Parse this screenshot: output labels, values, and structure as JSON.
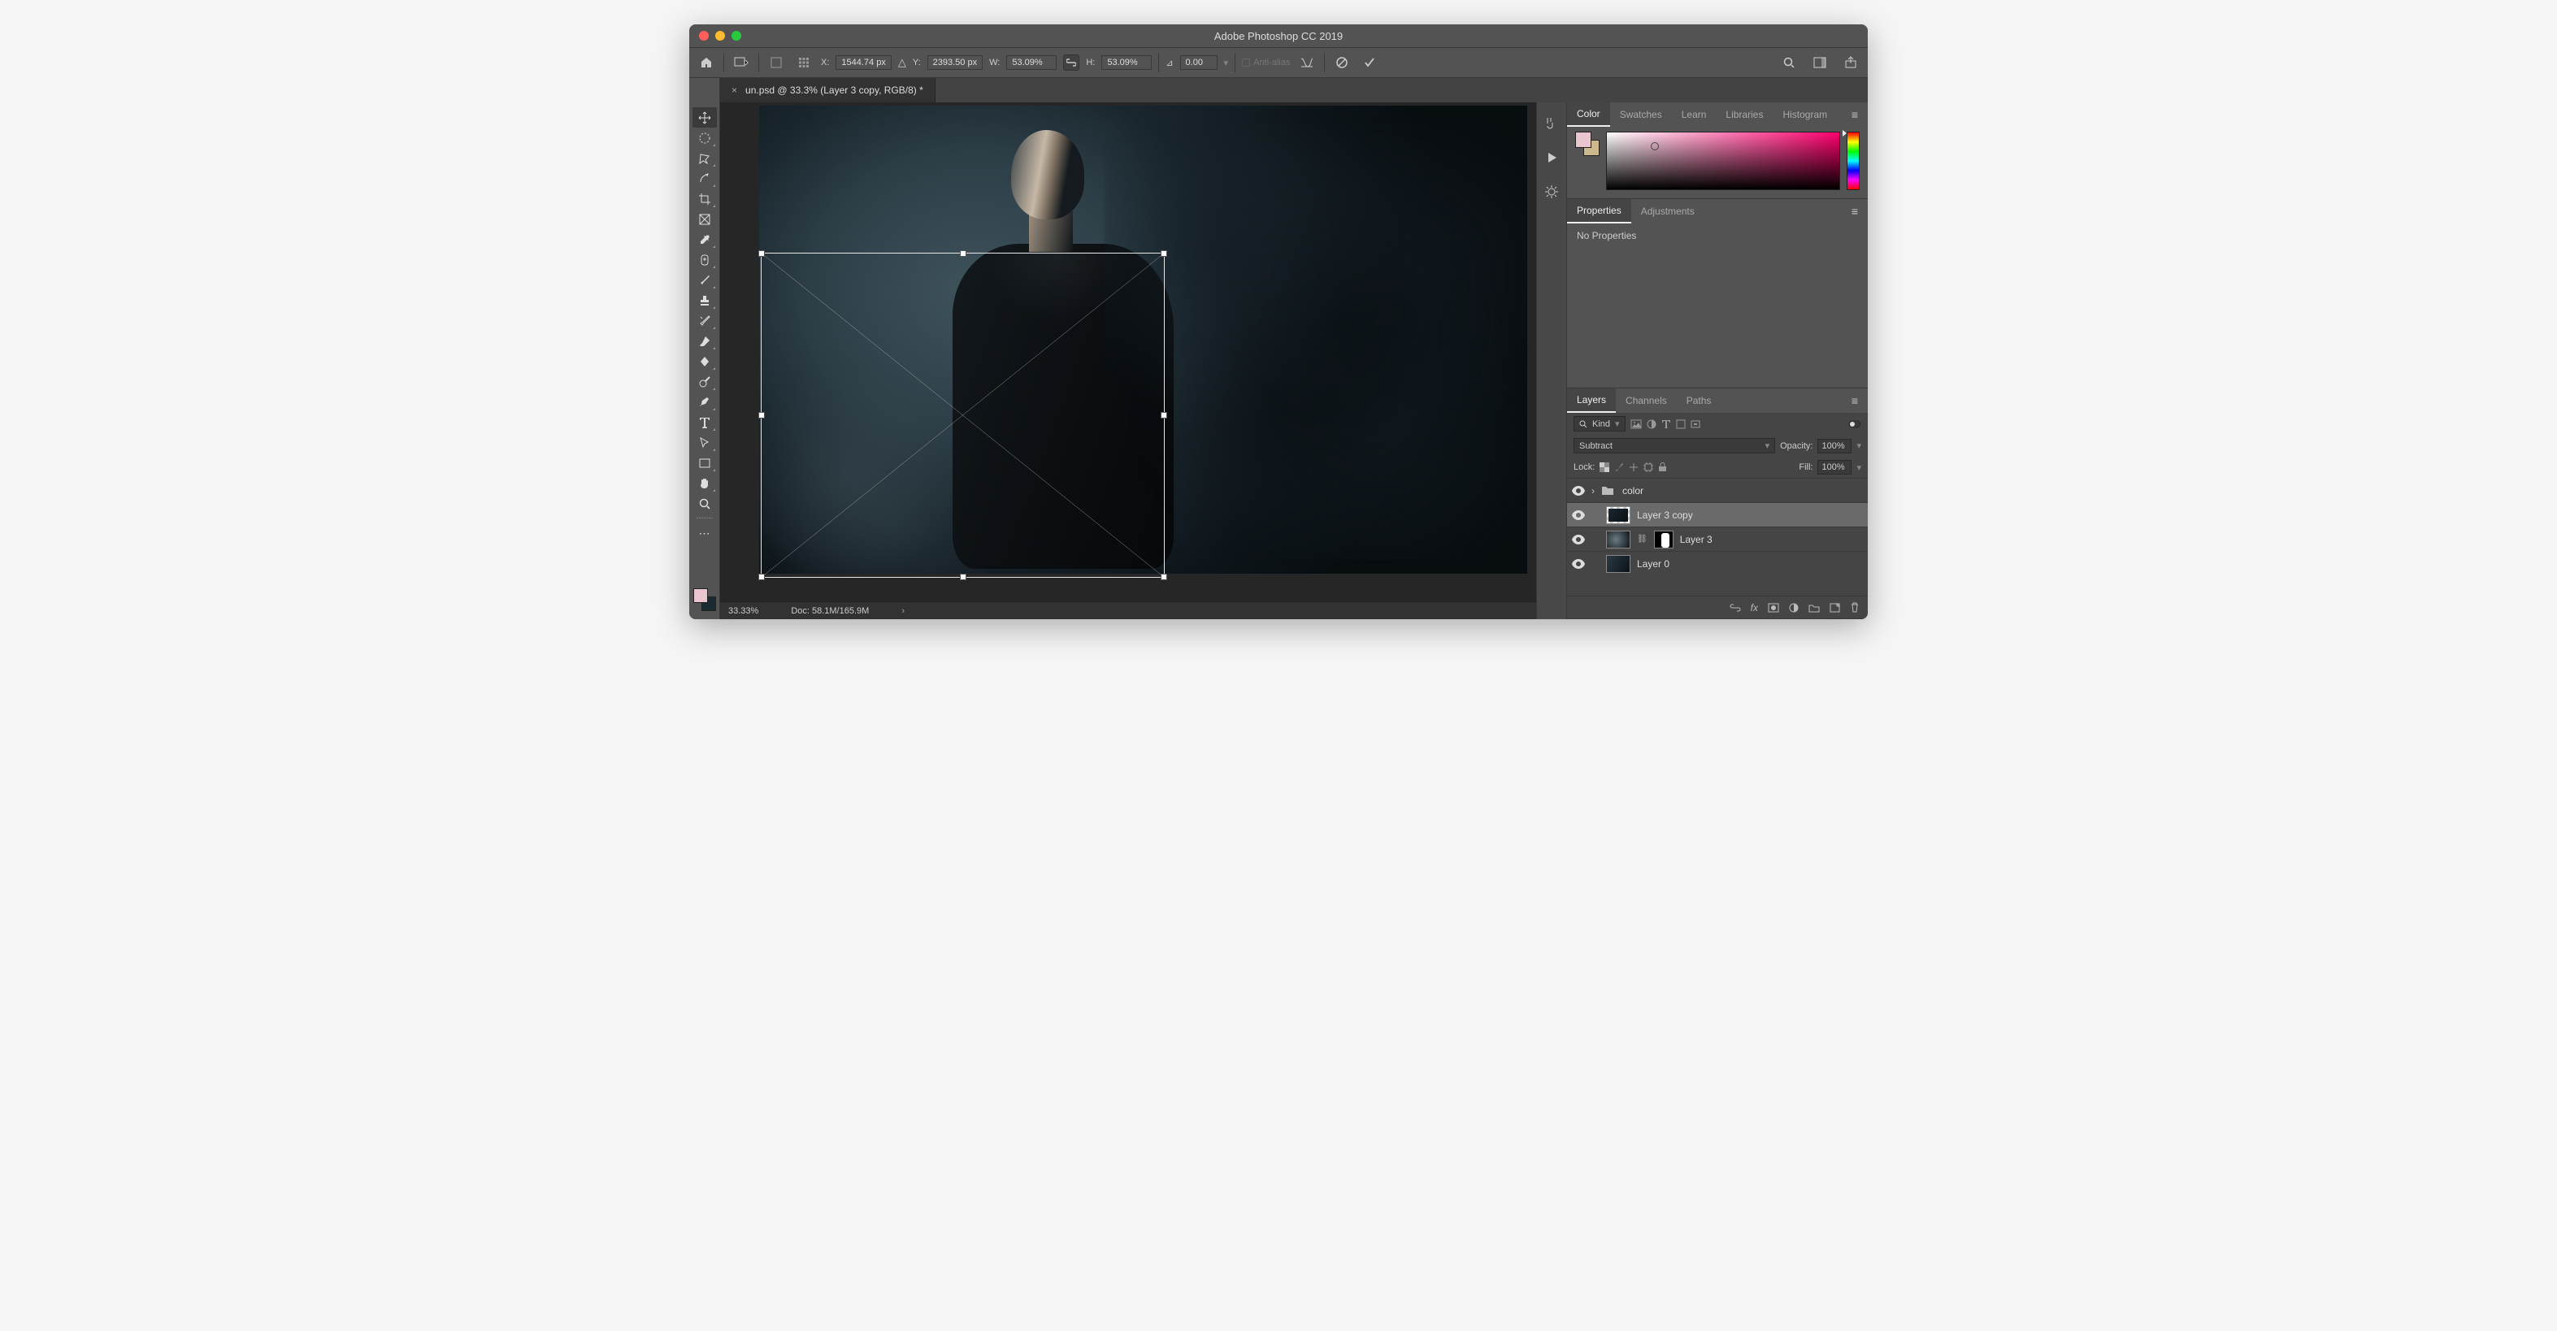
{
  "app": {
    "title": "Adobe Photoshop CC 2019"
  },
  "optionsbar": {
    "x_label": "X:",
    "x": "1544.74 px",
    "y_label": "Y:",
    "y": "2393.50 px",
    "w_label": "W:",
    "w": "53.09%",
    "h_label": "H:",
    "h": "53.09%",
    "angle_label": "∆",
    "angle": "0.00",
    "antialias_label": "Anti-alias"
  },
  "document_tab": {
    "close": "×",
    "title": "un.psd @ 33.3% (Layer 3 copy, RGB/8) *"
  },
  "statusbar": {
    "zoom": "33.33%",
    "doc": "Doc: 58.1M/165.9M"
  },
  "panels": {
    "color_tabs": [
      "Color",
      "Swatches",
      "Learn",
      "Libraries",
      "Histogram"
    ],
    "properties_tabs": [
      "Properties",
      "Adjustments"
    ],
    "properties_text": "No Properties",
    "layers_tabs": [
      "Layers",
      "Channels",
      "Paths"
    ]
  },
  "layers_panel": {
    "filter_label": "Kind",
    "blend_mode": "Subtract",
    "opacity_label": "Opacity:",
    "opacity": "100%",
    "lock_label": "Lock:",
    "fill_label": "Fill:",
    "fill": "100%",
    "items": [
      {
        "name": "color",
        "type": "group"
      },
      {
        "name": "Layer 3 copy",
        "type": "layer",
        "selected": true
      },
      {
        "name": "Layer 3",
        "type": "layer_masked"
      },
      {
        "name": "Layer 0",
        "type": "layer"
      }
    ]
  }
}
